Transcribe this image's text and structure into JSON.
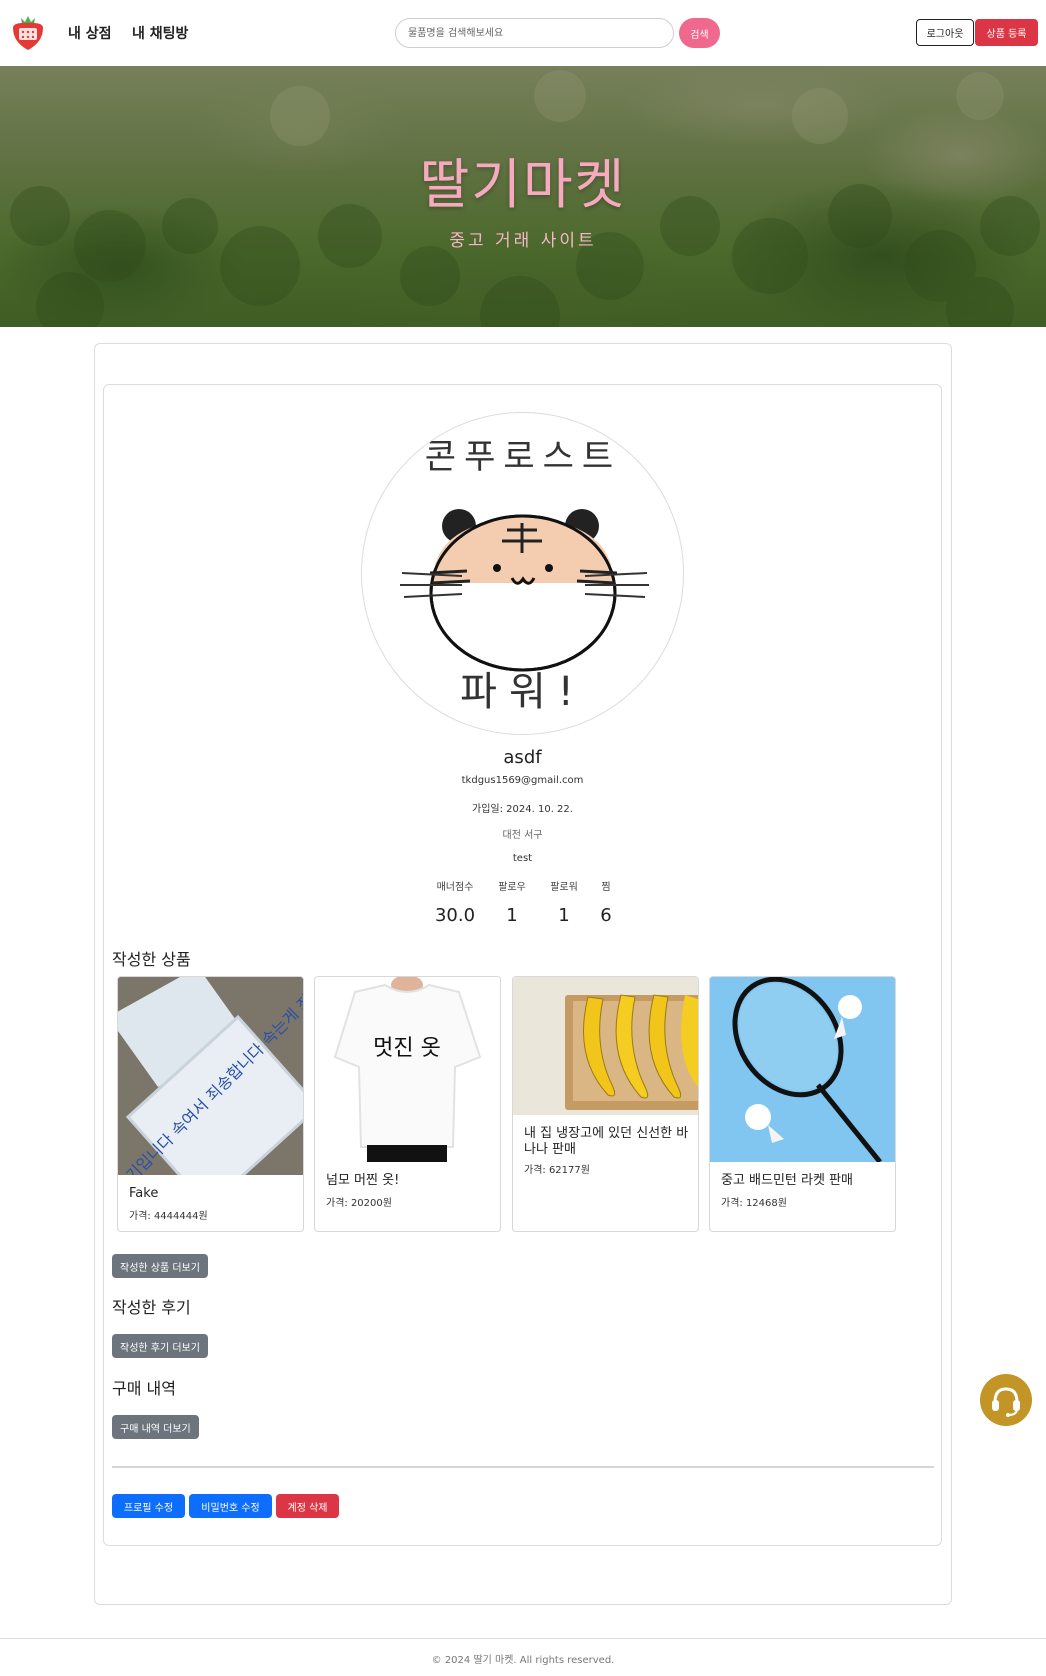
{
  "nav": {
    "links": [
      "내 상점",
      "내 채팅방"
    ],
    "search_placeholder": "물품명을 검색해보세요",
    "search_label": "검색",
    "logout_label": "로그아웃",
    "register_label": "상품 등록"
  },
  "hero": {
    "title": "딸기마켓",
    "subtitle": "중고 거래 사이트"
  },
  "profile": {
    "avatar_text_top": "콘푸로스트",
    "avatar_text_bottom": "파워!",
    "username": "asdf",
    "email": "tkdgus1569@gmail.com",
    "joined": "가입일: 2024. 10. 22.",
    "location": "대전 서구",
    "bio": "test",
    "stats": [
      {
        "label": "매너점수",
        "value": "30.0"
      },
      {
        "label": "팔로우",
        "value": "1"
      },
      {
        "label": "팔로워",
        "value": "1"
      },
      {
        "label": "찜",
        "value": "6"
      }
    ]
  },
  "sections": {
    "products_title": "작성한 상품",
    "products_more": "작성한 상품 더보기",
    "reviews_title": "작성한 후기",
    "reviews_more": "작성한 후기 더보기",
    "purchases_title": "구매 내역",
    "purchases_more": "구매 내역 더보기"
  },
  "products": [
    {
      "name": "Fake",
      "price": "가격: 4444444원",
      "note_text": "사기입니다 속여서 죄송합니다 속는게 죄"
    },
    {
      "name": "넘모 머찐 옷!",
      "price": "가격: 20200원",
      "shirt_text": "멋진 옷"
    },
    {
      "name": "내 집 냉장고에 있던 신선한 바나나 판매",
      "price": "가격: 62177원"
    },
    {
      "name": "중고 배드민턴 라켓 판매",
      "price": "가격: 12468원"
    }
  ],
  "actions": {
    "edit_profile": "프로필 수정",
    "change_password": "비밀번호 수정",
    "delete_account": "계정 삭제"
  },
  "footer": {
    "text": "© 2024 딸기 마켓. All rights reserved."
  },
  "colors": {
    "search_button": "#f0688e",
    "register_button": "#dc3545",
    "gray_button": "#6c757d",
    "blue_button": "#0d6efd",
    "support_button": "#c29526",
    "hero_title": "#f7a9c0"
  },
  "icons": {
    "logo": "strawberry-icon",
    "support": "headset-icon"
  }
}
